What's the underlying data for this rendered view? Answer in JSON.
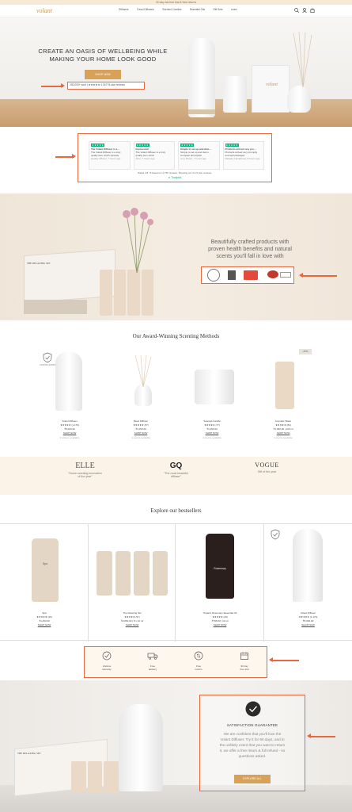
{
  "topbar": {
    "text": "30 day risk free trial & free returns"
  },
  "nav": {
    "logo": "volant",
    "links": [
      "Diffusers",
      "Travel Diffusers",
      "Scented Candles",
      "Essential Oils",
      "Gift Sets",
      "Learn"
    ]
  },
  "hero": {
    "headline_1": "CREATE AN OASIS OF WELLBEING WHILE",
    "headline_2": "MAKING YOUR HOME LOOK GOOD",
    "cta": "SHOP NOW",
    "social_proof": "250,000+ sold | ★★★★★ 4,347+5-star reviews",
    "box_logo": "volant"
  },
  "trustpilot": {
    "reviews": [
      {
        "title": "The Volant Diffuser is a…",
        "body": "The Volant Diffuser is a truly quality item which spreads",
        "meta": "Quality diffuser, 7 hours ago"
      },
      {
        "title": "Impressive!",
        "body": "The Volant Diffuser is a truly quality item which",
        "meta": "Alice, 7 hours ago"
      },
      {
        "title": "Simple to set up and dem…",
        "body": "Simple to set up and demo. Compact and stylish",
        "meta": "Amy Brown, 7 hours ago"
      },
      {
        "title": "Products arrived very pro…",
        "body": "Products arrived very promptly and well packaged",
        "meta": "Rafaela Carvalhoea, 8 hours ago"
      }
    ],
    "summary": "Rated 4.8 / 5 based on 4,750 reviews. Showing our 4 & 5 star reviews.",
    "brand": "Trustpilot"
  },
  "values": {
    "line1": "Beautifully crafted products with",
    "line2": "proven health benefits and natural",
    "line3": "scents you'll fall in love with",
    "set_title": "THE RELAXING SET"
  },
  "scenting": {
    "title": "Our Award-Winning Scenting Methods",
    "sale": "-25%",
    "award_badge": "LIFETIME WARRANTY",
    "products": [
      {
        "name": "Volant Diffuser",
        "rating": "★★★★★ (1,176)",
        "price": "₹5,000.00",
        "cta": "SHOP NOW",
        "note": "3 colours available"
      },
      {
        "name": "Reed Diffuser",
        "rating": "★★★★★ (57)",
        "price": "₹1,050.00",
        "cta": "SHOP NOW",
        "note": "4 scents available"
      },
      {
        "name": "Scented Candle",
        "rating": "★★★★★ (77)",
        "price": "₹1,050.00",
        "cta": "SHOP NOW",
        "note": "4 scents available"
      },
      {
        "name": "Aromatic Water",
        "rating": "★★★★★ (84)",
        "price": "₹1,050.00 | 100 ml",
        "cta": "SHOP NOW",
        "note": "4 scents available"
      }
    ]
  },
  "press": [
    {
      "logo": "ELLE",
      "quote_1": "\"Home scenting innovation",
      "quote_2": "of the year\""
    },
    {
      "logo": "GQ",
      "quote_1": "\"The most beautiful",
      "quote_2": "diffuser\""
    },
    {
      "logo": "VOGUE",
      "quote_1": "Gift of the year",
      "quote_2": ""
    }
  ],
  "bestsellers": {
    "title": "Explore our bestsellers",
    "items": [
      {
        "name": "Spa",
        "rating": "★★★★★ (29)",
        "price": "₹1,050.00",
        "cta": "SHOP NOW",
        "bottle_label": "Spa"
      },
      {
        "name": "The Relaxing Set",
        "rating": "★★★★★ (57)",
        "price": "₹2,050.00 | 8 x 10 ml",
        "cta": "SHOP NOW",
        "bottle_label": ""
      },
      {
        "name": "Organic Rosemary Essential Oil",
        "rating": "★★★★★ (29)",
        "price": "₹795.00 | 10 ml",
        "cta": "SHOP NOW",
        "bottle_label": "Rosemary"
      },
      {
        "name": "Volant Diffuser",
        "rating": "★★★★★ (1,176)",
        "price": "₹5,000.00",
        "cta": "SHOP NOW",
        "bottle_label": ""
      }
    ]
  },
  "benefits": [
    {
      "icon": "check-circle-icon",
      "label_1": "Lifetime",
      "label_2": "warranty"
    },
    {
      "icon": "truck-icon",
      "label_1": "Free",
      "label_2": "delivery"
    },
    {
      "icon": "return-icon",
      "label_1": "Free",
      "label_2": "returns"
    },
    {
      "icon": "calendar-icon",
      "label_1": "90 day",
      "label_2": "free trial"
    }
  ],
  "guarantee": {
    "title": "SATISFACTION GUARANTEE",
    "body_1": "We are confident that you'll love the",
    "body_2": "Volant Diffuser. Try it for 90 days, and in",
    "body_3": "the unlikely event that you want to return",
    "body_4": "it, we offer a free return & full refund - no",
    "body_5": "questions asked.",
    "cta": "EXPLORE ALL"
  },
  "colors": {
    "accent": "#e8693f",
    "gold": "#d9a057",
    "trust_green": "#00b67a"
  }
}
